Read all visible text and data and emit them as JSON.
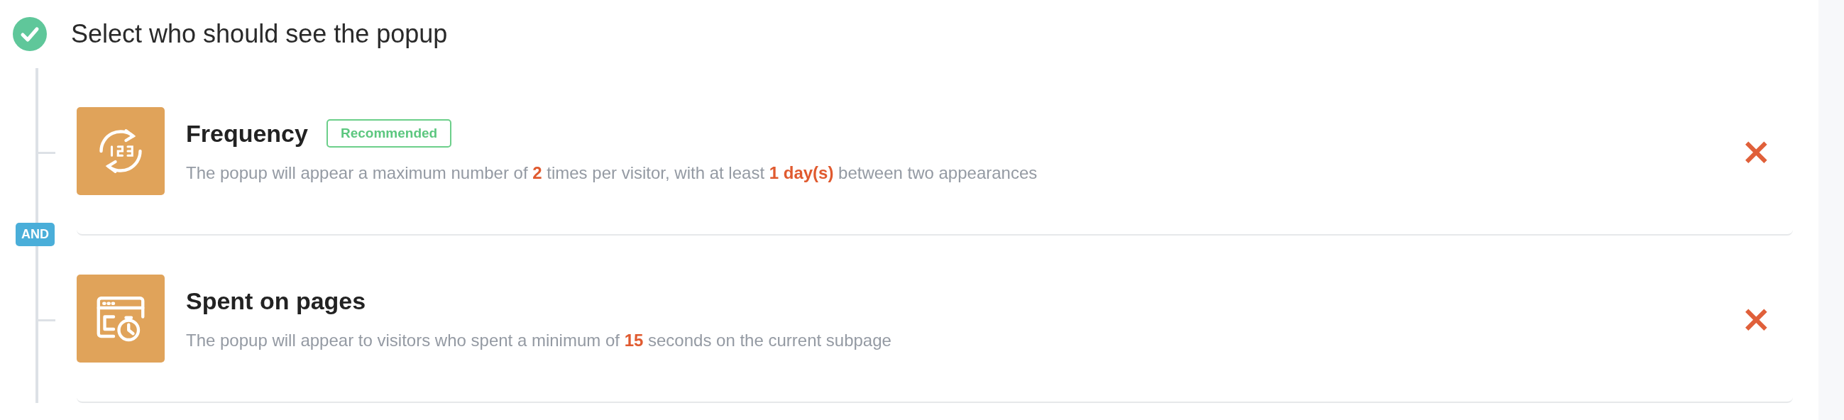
{
  "step": {
    "title": "Select who should see the popup",
    "completed": true
  },
  "conditions": [
    {
      "kind": "frequency",
      "title": "Frequency",
      "badge": "Recommended",
      "description": "The popup will appear a maximum number of **2** times per visitor, with at least **1 day(s)** between two appearances",
      "remove": "×"
    },
    {
      "kind": "time_on_page",
      "joiner": "AND",
      "title": "Spent on pages",
      "description": "The popup will appear to visitors who spent a minimum of **15** seconds on the current subpage",
      "remove": "×"
    }
  ]
}
